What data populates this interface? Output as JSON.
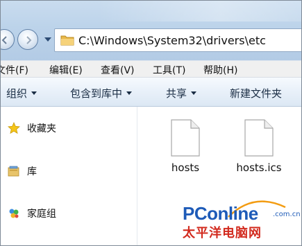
{
  "address_bar": {
    "path": "C:\\Windows\\System32\\drivers\\etc"
  },
  "menu": {
    "items": [
      "文件(F)",
      "编辑(E)",
      "查看(V)",
      "工具(T)",
      "帮助(H)"
    ]
  },
  "toolbar": {
    "organize": "组织",
    "include_in_library": "包含到库中",
    "share": "共享",
    "new_folder": "新建文件夹"
  },
  "nav_pane": {
    "items": [
      {
        "label": "收藏夹",
        "icon": "star-icon"
      },
      {
        "label": "库",
        "icon": "library-icon"
      },
      {
        "label": "家庭组",
        "icon": "homegroup-icon"
      }
    ]
  },
  "files": [
    {
      "name": "hosts",
      "icon": "file-icon"
    },
    {
      "name": "hosts.ics",
      "icon": "file-icon"
    }
  ],
  "watermark": {
    "brand": "PConline",
    "domain": ".com.cn",
    "chinese": "太平洋电脑网",
    "colors": {
      "blue": "#1e5bb8",
      "red": "#d22a1e",
      "orange": "#f39c12"
    }
  }
}
